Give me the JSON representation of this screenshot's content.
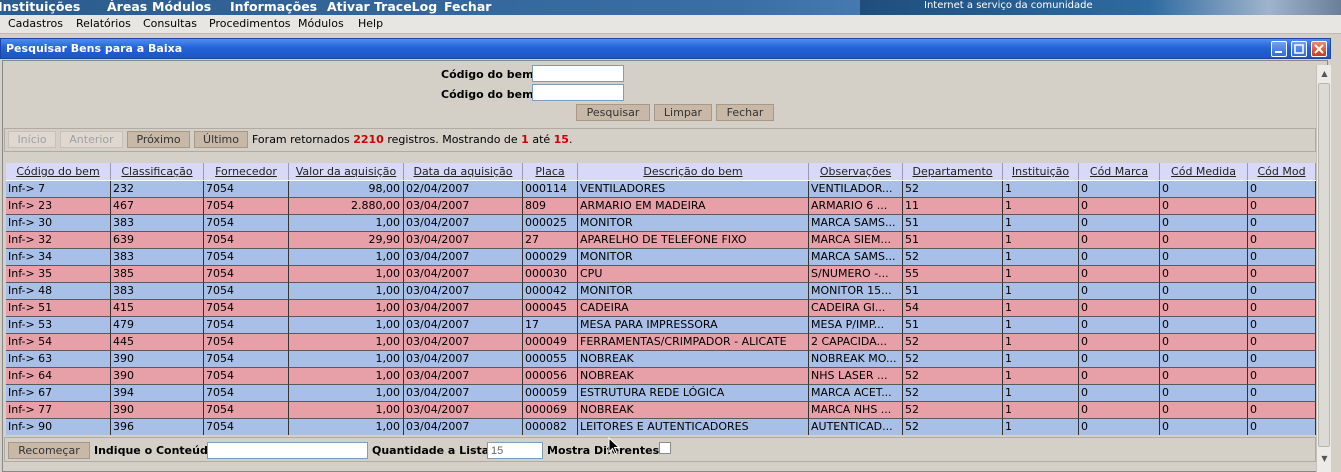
{
  "topbar": {
    "items": [
      "Instituições",
      "Áreas",
      "Módulos",
      "Informações",
      "Ativar TraceLog",
      "Fechar"
    ],
    "tagline": "Internet a serviço da comunidade"
  },
  "menubar": {
    "items": [
      "Cadastros",
      "Relatórios",
      "Consultas",
      "Procedimentos",
      "Módulos",
      "Help"
    ]
  },
  "window": {
    "title": "Pesquisar Bens para a Baixa"
  },
  "search": {
    "label1": "Código do bem:",
    "value1": "",
    "label2": "Código do bem:",
    "value2": "",
    "btn_search": "Pesquisar",
    "btn_clear": "Limpar",
    "btn_close": "Fechar"
  },
  "nav": {
    "first": "Início",
    "previous": "Anterior",
    "next": "Próximo",
    "last": "Último",
    "text_prefix": "Foram retornados",
    "count": "2210",
    "text_mid": "registros. Mostrando de",
    "from": "1",
    "text_to": "até",
    "to": "15",
    "text_end": "."
  },
  "table": {
    "columns": [
      "Código do bem",
      "Classificação",
      "Fornecedor",
      "Valor da aquisição",
      "Data da aquisição",
      "Placa",
      "Descrição do bem",
      "Observações",
      "Departamento",
      "Instituição",
      "Cód Marca",
      "Cód Medida",
      "Cód Mod"
    ],
    "rows": [
      [
        "Inf-> 7",
        "232",
        "7054",
        "98,00",
        "02/04/2007",
        "000114",
        "VENTILADORES",
        "VENTILADOR...",
        "52",
        "1",
        "0",
        "0",
        "0"
      ],
      [
        "Inf-> 23",
        "467",
        "7054",
        "2.880,00",
        "03/04/2007",
        "809",
        "ARMARIO EM MADEIRA",
        "ARMARIO 6 ...",
        "11",
        "1",
        "0",
        "0",
        "0"
      ],
      [
        "Inf-> 30",
        "383",
        "7054",
        "1,00",
        "03/04/2007",
        "000025",
        "MONITOR",
        "MARCA SAMS...",
        "51",
        "1",
        "0",
        "0",
        "0"
      ],
      [
        "Inf-> 32",
        "639",
        "7054",
        "29,90",
        "03/04/2007",
        "27",
        "APARELHO DE TELEFONE FIXO",
        "MARCA SIEM...",
        "51",
        "1",
        "0",
        "0",
        "0"
      ],
      [
        "Inf-> 34",
        "383",
        "7054",
        "1,00",
        "03/04/2007",
        "000029",
        "MONITOR",
        "MARCA SAMS...",
        "52",
        "1",
        "0",
        "0",
        "0"
      ],
      [
        "Inf-> 35",
        "385",
        "7054",
        "1,00",
        "03/04/2007",
        "000030",
        "CPU",
        "S/NUMERO -...",
        "55",
        "1",
        "0",
        "0",
        "0"
      ],
      [
        "Inf-> 48",
        "383",
        "7054",
        "1,00",
        "03/04/2007",
        "000042",
        "MONITOR",
        "MONITOR 15...",
        "51",
        "1",
        "0",
        "0",
        "0"
      ],
      [
        "Inf-> 51",
        "415",
        "7054",
        "1,00",
        "03/04/2007",
        "000045",
        "CADEIRA",
        "CADEIRA GI...",
        "54",
        "1",
        "0",
        "0",
        "0"
      ],
      [
        "Inf-> 53",
        "479",
        "7054",
        "1,00",
        "03/04/2007",
        "17",
        "MESA PARA IMPRESSORA",
        "MESA P/IMP...",
        "51",
        "1",
        "0",
        "0",
        "0"
      ],
      [
        "Inf-> 54",
        "445",
        "7054",
        "1,00",
        "03/04/2007",
        "000049",
        "FERRAMENTAS/CRIMPADOR - ALICATE",
        "2 CAPACIDA...",
        "52",
        "1",
        "0",
        "0",
        "0"
      ],
      [
        "Inf-> 63",
        "390",
        "7054",
        "1,00",
        "03/04/2007",
        "000055",
        "NOBREAK",
        "NOBREAK MO...",
        "52",
        "1",
        "0",
        "0",
        "0"
      ],
      [
        "Inf-> 64",
        "390",
        "7054",
        "1,00",
        "03/04/2007",
        "000056",
        "NOBREAK",
        "NHS LASER ...",
        "52",
        "1",
        "0",
        "0",
        "0"
      ],
      [
        "Inf-> 67",
        "394",
        "7054",
        "1,00",
        "03/04/2007",
        "000059",
        "ESTRUTURA REDE LÓGICA",
        "MARCA ACET...",
        "52",
        "1",
        "0",
        "0",
        "0"
      ],
      [
        "Inf-> 77",
        "390",
        "7054",
        "1,00",
        "03/04/2007",
        "000069",
        "NOBREAK",
        "MARCA NHS ...",
        "52",
        "1",
        "0",
        "0",
        "0"
      ],
      [
        "Inf-> 90",
        "396",
        "7054",
        "1,00",
        "03/04/2007",
        "000082",
        "LEITORES E AUTENTICADORES",
        "AUTENTICAD...",
        "52",
        "1",
        "0",
        "0",
        "0"
      ]
    ]
  },
  "bottom": {
    "restart": "Recomeçar",
    "content_label": "Indique o Conteúdo:",
    "content_value": "",
    "qty_label": "Quantidade a Listar:",
    "qty_value": "15",
    "show_diff_label": "Mostra Diferentes:"
  },
  "colors": {
    "row_blue": "#a8c0e8",
    "row_pink": "#e8a0a8",
    "header": "#d8d8f8",
    "titlebar": "#2463d8",
    "highlight": "#d00000"
  }
}
